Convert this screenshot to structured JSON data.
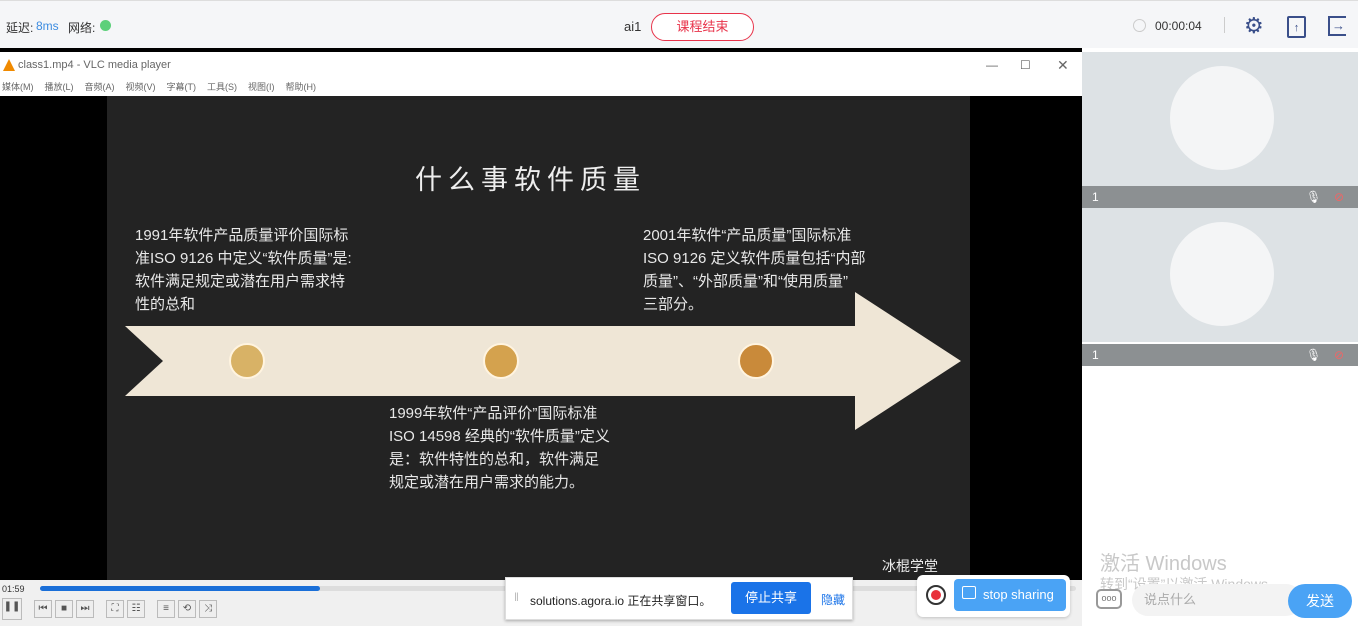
{
  "topbar": {
    "latency_label": "延迟:",
    "latency_value": "8ms",
    "network_label": "网络:",
    "user": "ai1",
    "end_class": "课程结束",
    "timer": "00:00:04",
    "accent": "#e8334a"
  },
  "vlc": {
    "title": "class1.mp4 - VLC media player",
    "menu": [
      "媒体(M)",
      "播放(L)",
      "音频(A)",
      "视频(V)",
      "字幕(T)",
      "工具(S)",
      "视图(I)",
      "帮助(H)"
    ],
    "time": "01:59",
    "progress": 0.27
  },
  "slide": {
    "title": "什么事软件质量",
    "text1": [
      "1991年软件产品质量评价国际标",
      "准ISO 9126 中定义“软件质量”是:",
      "软件满足规定或潜在用户需求特",
      "性的总和"
    ],
    "text2": [
      "1999年软件“产品评价”国际标准",
      "ISO 14598 经典的“软件质量”定义",
      "是：软件特性的总和，软件满足",
      "规定或潜在用户需求的能力。"
    ],
    "text3": [
      "2001年软件“产品质量”国际标准",
      "ISO 9126 定义软件质量包括“内部",
      "质量”、“外部质量”和“使用质量”",
      "三部分。"
    ],
    "watermark": "冰棍学堂"
  },
  "participants": [
    {
      "name": "1"
    },
    {
      "name": "1"
    }
  ],
  "share_notice": {
    "text": "solutions.agora.io 正在共享窗口。",
    "stop": "停止共享",
    "hide": "隐藏"
  },
  "stop_sharing": "stop sharing",
  "activation": {
    "title": "激活 Windows",
    "sub": "转到“设置”以激活 Windows。"
  },
  "chat": {
    "placeholder": "说点什么",
    "send": "发送"
  }
}
